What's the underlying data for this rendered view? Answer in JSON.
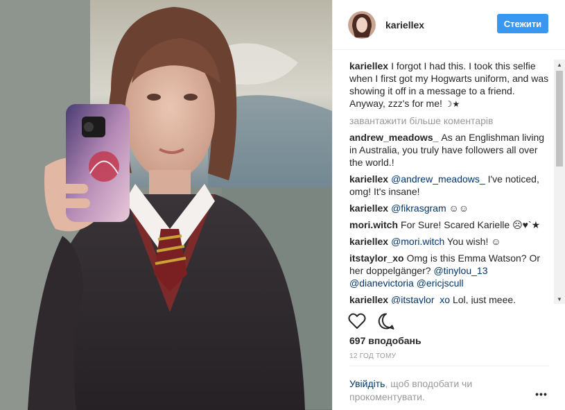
{
  "post": {
    "username": "kariellex",
    "follow_label": "Стежити",
    "caption": {
      "user": "kariellex",
      "text": "I forgot I had this. I took this selfie when I first got my Hogwarts uniform, and was showing it off in a message to a friend. Anyway, zzz's for me! ",
      "emoji": "☽★"
    },
    "load_more": "завантажити більше коментарів",
    "comments": [
      {
        "user": "andrew_meadows_",
        "mention": "",
        "text": "As an Englishman living in Australia, you truly have followers all over the world.!"
      },
      {
        "user": "kariellex",
        "mention": "@andrew_meadows_",
        "text": " I've noticed, omg! It's insane!"
      },
      {
        "user": "kariellex",
        "mention": "@fikrasgram",
        "text": " ☺☺"
      },
      {
        "user": "mori.witch",
        "mention": "",
        "text": "For Sure! Scared Karielle ☹♥`★"
      },
      {
        "user": "kariellex",
        "mention": "@mori.witch",
        "text": " You wish! ☺"
      },
      {
        "user": "itstaylor_xo",
        "mention": "",
        "text": "Omg is this Emma Watson? Or her doppelgänger? ",
        "mentions_after": [
          "@tinylou_13",
          "@dianevictoria",
          "@ericjscull"
        ]
      },
      {
        "user": "kariellex",
        "mention": "@itstaylor_xo",
        "text": " Lol, just meee."
      }
    ],
    "likes": "697 вподобань",
    "time": "12 ГОД ТОМУ",
    "login_link": "Увійдіть",
    "login_text": ", щоб вподобати чи прокоментувати.",
    "more_label": "•••",
    "icons": {
      "like": "heart-outline-icon",
      "comment": "comment-bubble-icon",
      "more": "more-dots-icon"
    }
  }
}
